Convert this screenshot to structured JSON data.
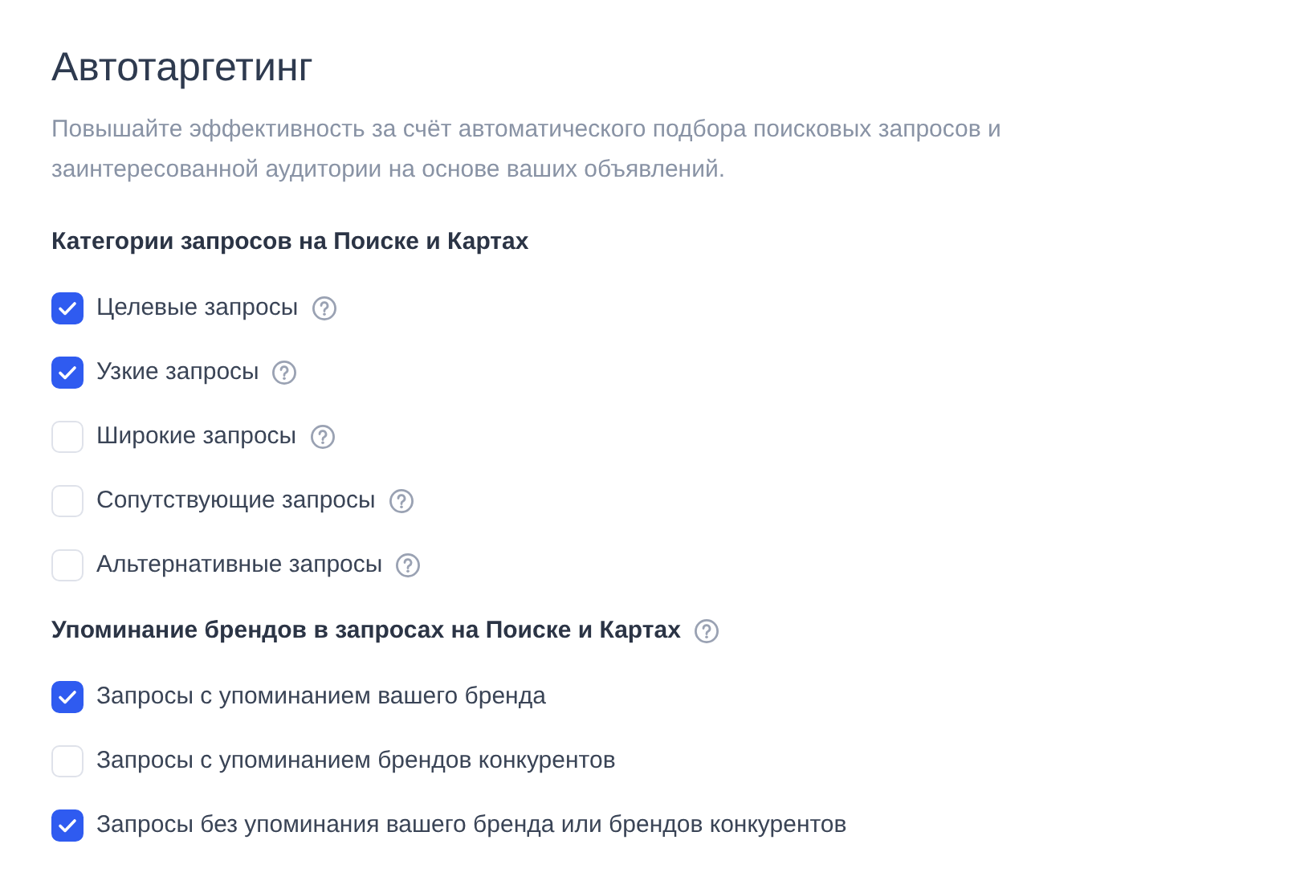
{
  "title": "Автотаргетинг",
  "description": "Повышайте эффективность за счёт автоматического подбора поисковых запросов и заинтересованной аудитории на основе ваших объявлений.",
  "groups": [
    {
      "heading": "Категории запросов на Поиске и Картах",
      "help": false,
      "options": [
        {
          "label": "Целевые запросы",
          "checked": true,
          "help": true
        },
        {
          "label": "Узкие запросы",
          "checked": true,
          "help": true
        },
        {
          "label": "Широкие запросы",
          "checked": false,
          "help": true
        },
        {
          "label": "Сопутствующие запросы",
          "checked": false,
          "help": true
        },
        {
          "label": "Альтернативные запросы",
          "checked": false,
          "help": true
        }
      ]
    },
    {
      "heading": "Упоминание брендов в запросах на Поиске и Картах",
      "help": true,
      "options": [
        {
          "label": "Запросы с упоминанием вашего бренда",
          "checked": true,
          "help": false
        },
        {
          "label": "Запросы с упоминанием брендов конкурентов",
          "checked": false,
          "help": false
        },
        {
          "label": "Запросы без упоминания вашего бренда или брендов конкурентов",
          "checked": true,
          "help": false
        }
      ]
    }
  ]
}
